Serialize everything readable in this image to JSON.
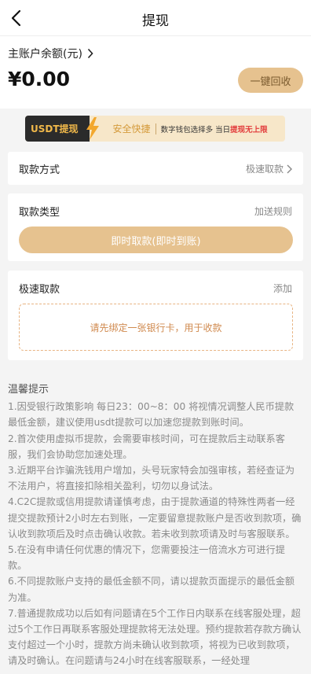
{
  "header": {
    "title": "提现"
  },
  "balance": {
    "label": "主账户余额(元)",
    "amount": "¥0.00",
    "recall_label": "一键回收"
  },
  "banner": {
    "tag": "USDT提现",
    "safe": "安全快捷",
    "desc_prefix": "数字钱包选择多 当日",
    "desc_highlight": "提现无上限"
  },
  "method": {
    "label": "取款方式",
    "value": "极速取款"
  },
  "type": {
    "label": "取款类型",
    "rules": "加送规则",
    "button": "即时取款(即时到账)"
  },
  "fast": {
    "label": "极速取款",
    "add": "添加",
    "bind_hint": "请先绑定一张银行卡，用于收款"
  },
  "tips": {
    "title": "温馨提示",
    "items": [
      "1.因受银行政策影响 每日23：00~8：00 将视情况调整人民币提款最低金额，建议使用usdt提款可以加速您提款到账时间。",
      "2.首次使用虚拟币提款，会需要审核时间，可在提款后主动联系客服，我们会协助您加速处理。",
      "3.近期平台诈骗洗钱用户增加，头号玩家特会加强审核，若经查证为不法用户，将直接扣除相关盈利，切勿以身试法。",
      "4.C2C提款或信用提款请谨慎考虑，由于提款通道的特殊性两者一经提交提款预计2小时左右到账，一定要留意提款账户是否收到款项，确认收到款项后及时点击确认收款。若未收到款项请及时与客服联系。",
      "5.在没有申请任何优惠的情况下，您需要投注一倍流水方可进行提款。",
      "6.不同提款账户支持的最低金额不同，请以提款页面提示的最低金额为准。",
      "7.普通提款成功以后如有问题请在5个工作日内联系在线客服处理，超过5个工作日再联系客服处理提款将无法处理。预约提款若存款方确认支付超过一个小时，提款方尚未确认收到款项，将视为已收到款项，请及时确认。在问题请与24小时在线客服联系，一经处理"
    ]
  }
}
